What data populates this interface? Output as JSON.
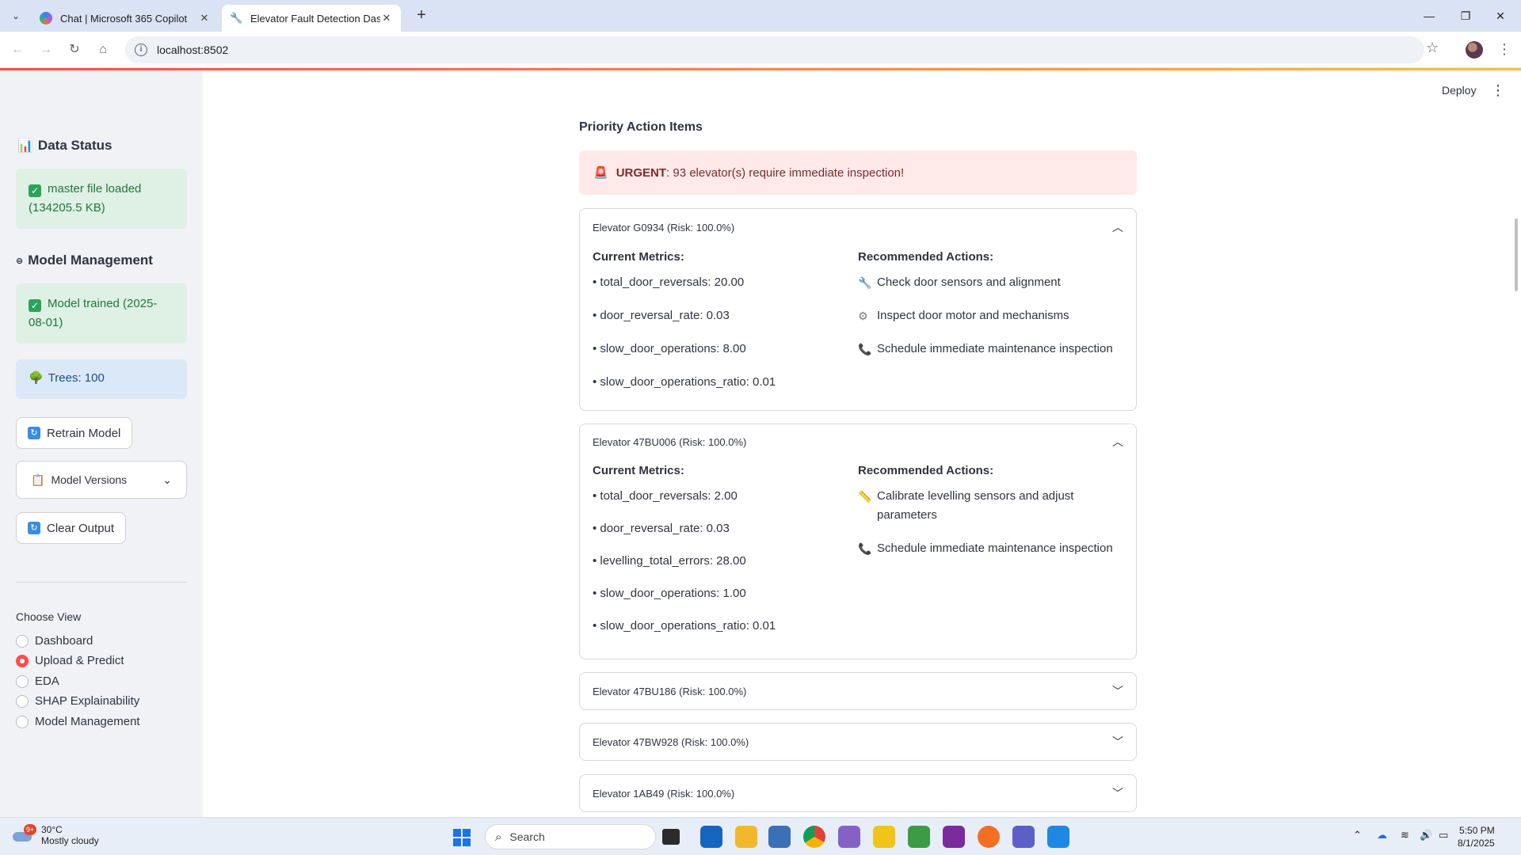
{
  "browser": {
    "tabs": [
      {
        "title": "Chat | Microsoft 365 Copilot"
      },
      {
        "title": "Elevator Fault Detection Dashb"
      }
    ],
    "url": "localhost:8502"
  },
  "app": {
    "deploy_label": "Deploy"
  },
  "sidebar": {
    "data_status_heading": "Data Status",
    "data_status_msg": "master file loaded (134205.5 KB)",
    "model_mgmt_heading": "Model Management",
    "model_trained_msg": "Model trained (2025-08-01)",
    "trees_msg": "Trees: 100",
    "retrain_label": "Retrain Model",
    "model_versions_label": "Model Versions",
    "clear_output_label": "Clear Output",
    "choose_view_label": "Choose View",
    "views": [
      {
        "label": "Dashboard",
        "selected": false
      },
      {
        "label": "Upload & Predict",
        "selected": true
      },
      {
        "label": "EDA",
        "selected": false
      },
      {
        "label": "SHAP Explainability",
        "selected": false
      },
      {
        "label": "Model Management",
        "selected": false
      }
    ]
  },
  "main": {
    "section_title": "Priority Action Items",
    "urgent_prefix": "URGENT",
    "urgent_text": ": 93 elevator(s) require immediate inspection!",
    "metrics_heading": "Current Metrics:",
    "actions_heading": "Recommended Actions:",
    "elevators": [
      {
        "title": "Elevator G0934 (Risk: 100.0%)",
        "expanded": true,
        "metrics": [
          "• total_door_reversals: 20.00",
          "• door_reversal_rate: 0.03",
          "• slow_door_operations: 8.00",
          "• slow_door_operations_ratio: 0.01"
        ],
        "actions": [
          {
            "icon": "wrench-icon",
            "text": "Check door sensors and alignment"
          },
          {
            "icon": "gear-icon",
            "text": "Inspect door motor and mechanisms"
          },
          {
            "icon": "phone-icon",
            "text": "Schedule immediate maintenance inspection"
          }
        ]
      },
      {
        "title": "Elevator 47BU006 (Risk: 100.0%)",
        "expanded": true,
        "metrics": [
          "• total_door_reversals: 2.00",
          "• door_reversal_rate: 0.03",
          "• levelling_total_errors: 28.00",
          "• slow_door_operations: 1.00",
          "• slow_door_operations_ratio: 0.01"
        ],
        "actions": [
          {
            "icon": "ruler-icon",
            "text": "Calibrate levelling sensors and adjust parameters"
          },
          {
            "icon": "phone-icon",
            "text": "Schedule immediate maintenance inspection"
          }
        ]
      },
      {
        "title": "Elevator 47BU186 (Risk: 100.0%)",
        "expanded": false
      },
      {
        "title": "Elevator 47BW928 (Risk: 100.0%)",
        "expanded": false
      },
      {
        "title": "Elevator 1AB49 (Risk: 100.0%)",
        "expanded": false
      }
    ]
  },
  "taskbar": {
    "temperature": "30°C",
    "weather": "Mostly cloudy",
    "weather_badge": "9+",
    "search_placeholder": "Search",
    "time": "5:50 PM",
    "date": "8/1/2025"
  }
}
